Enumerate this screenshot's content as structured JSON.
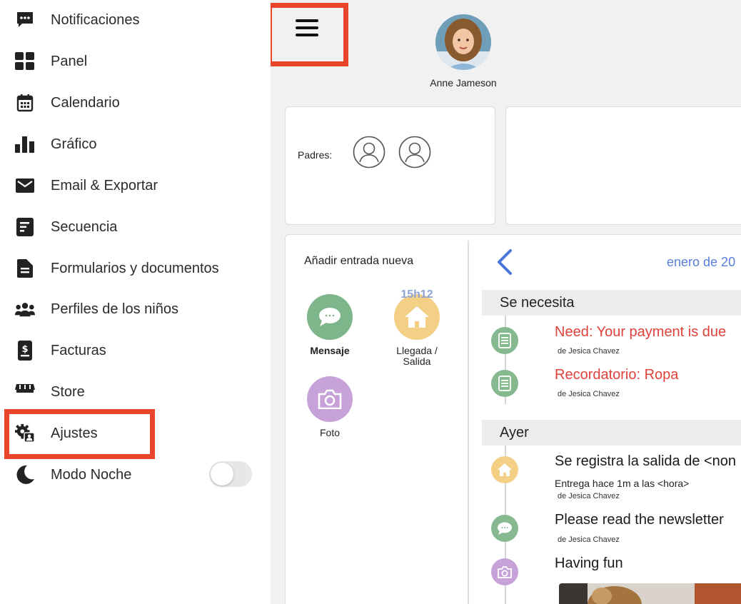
{
  "sidebar": {
    "items": [
      {
        "label": "Notificaciones",
        "icon": "chat-bubble-icon"
      },
      {
        "label": "Panel",
        "icon": "grid-icon"
      },
      {
        "label": "Calendario",
        "icon": "calendar-icon"
      },
      {
        "label": "Gráfico",
        "icon": "bar-chart-icon"
      },
      {
        "label": "Email & Exportar",
        "icon": "envelope-icon"
      },
      {
        "label": "Secuencia",
        "icon": "sequence-doc-icon"
      },
      {
        "label": "Formularios y documentos",
        "icon": "document-icon"
      },
      {
        "label": "Perfiles de los niños",
        "icon": "group-people-icon"
      },
      {
        "label": "Facturas",
        "icon": "invoice-icon"
      },
      {
        "label": "Store",
        "icon": "store-icon"
      },
      {
        "label": "Ajustes",
        "icon": "settings-icon"
      }
    ],
    "night_mode": {
      "label": "Modo Noche",
      "icon": "moon-icon",
      "enabled": false
    }
  },
  "header": {
    "child_name": "Anne Jameson"
  },
  "parents": {
    "label": "Padres:"
  },
  "add_entry": {
    "title": "Añadir entrada nueva",
    "actions": [
      {
        "label": "Mensaje",
        "color": "#7fb58a",
        "icon": "message-icon"
      },
      {
        "label": "Llegada / Salida",
        "line1": "Llegada /",
        "line2": "Salida",
        "badge": "15h12",
        "color": "#f4d087",
        "icon": "house-icon"
      },
      {
        "label": "Foto",
        "color": "#c7a2d9",
        "icon": "camera-icon"
      }
    ]
  },
  "feed": {
    "month": "enero de 20",
    "sections": [
      {
        "title": "Se necesita",
        "entries": [
          {
            "title": "Need: Your payment is due",
            "by": "de Jesica Chavez",
            "icon": "form-icon",
            "color": "#86b98f"
          },
          {
            "title": "Recordatorio: Ropa",
            "by": "de Jesica Chavez",
            "icon": "form-icon",
            "color": "#86b98f"
          }
        ]
      },
      {
        "title": "Ayer",
        "entries": [
          {
            "title": "Se registra la salida de <non",
            "subtitle": "Entrega hace 1m a las <hora>",
            "by": "de Jesica Chavez",
            "icon": "house-icon",
            "color": "#f4d087"
          },
          {
            "title": "Please read the newsletter",
            "by": "de Jesica Chavez",
            "icon": "message-icon",
            "color": "#86b98f"
          },
          {
            "title": "Having fun",
            "icon": "camera-icon",
            "color": "#c7a2d9"
          }
        ]
      }
    ]
  },
  "colors": {
    "accent_blue": "#5a7ed8",
    "alert_red": "#e0413a",
    "highlight": "#e8452c"
  }
}
